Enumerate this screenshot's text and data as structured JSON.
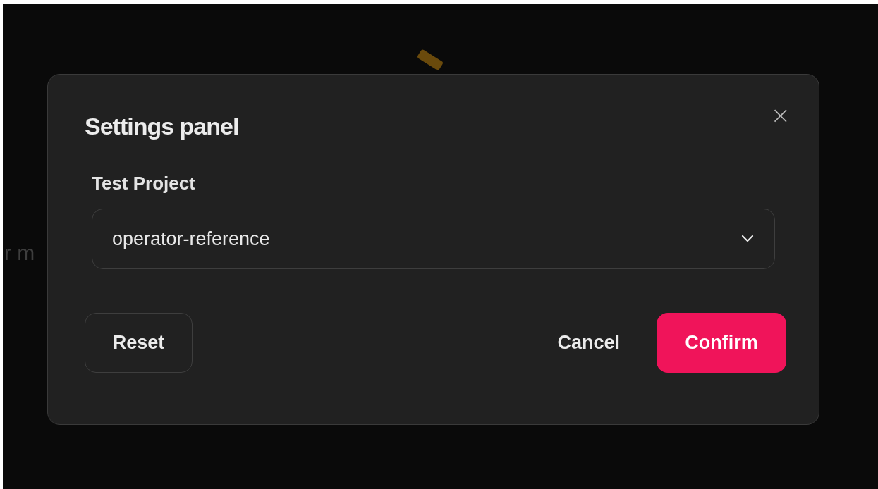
{
  "backdrop": {
    "text": "r m"
  },
  "dialog": {
    "title": "Settings panel",
    "close": "×",
    "field": {
      "label": "Test Project",
      "value": "operator-reference"
    },
    "buttons": [
      {
        "label": "Reset",
        "kind": "outline"
      },
      {
        "label": "Cancel",
        "kind": "text"
      },
      {
        "label": "Confirm",
        "kind": "primary"
      }
    ]
  }
}
